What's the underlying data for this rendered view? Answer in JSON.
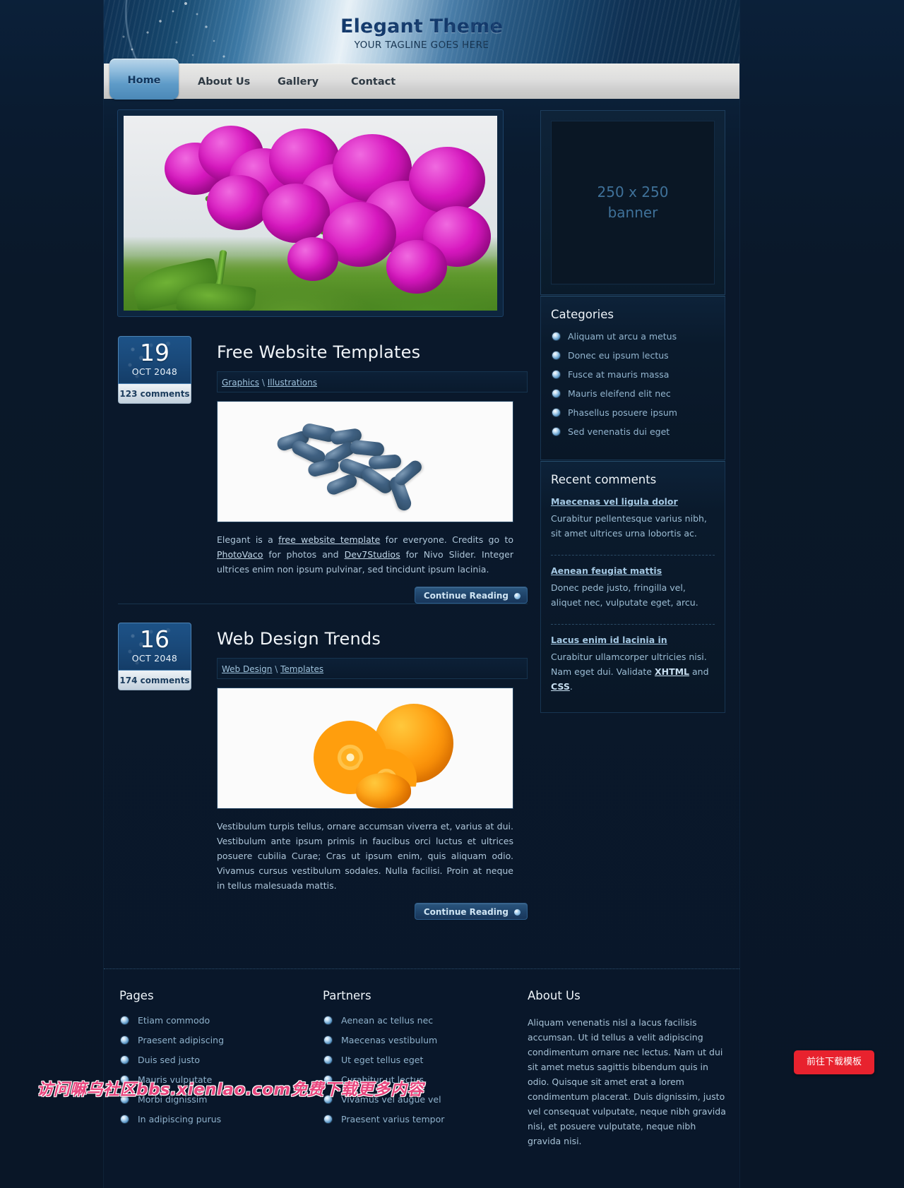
{
  "header": {
    "site_title": "Elegant Theme",
    "tagline": "YOUR TAGLINE GOES HERE"
  },
  "nav": {
    "items": [
      {
        "label": "Home",
        "active": true
      },
      {
        "label": "About Us",
        "active": false
      },
      {
        "label": "Gallery",
        "active": false
      },
      {
        "label": "Contact",
        "active": false
      }
    ]
  },
  "slider": {
    "alt": "purple orchid flowers photo"
  },
  "posts": [
    {
      "day": "19",
      "month_year": "OCT 2048",
      "comments": "123 comments",
      "title": "Free Website Templates",
      "categories": [
        "Graphics",
        "Illustrations"
      ],
      "category_separator": "\\",
      "image_alt": "blue pills photo",
      "body_parts": [
        {
          "t": "Elegant is a ",
          "link": false
        },
        {
          "t": "free website template",
          "link": true
        },
        {
          "t": " for everyone. Credits go to ",
          "link": false
        },
        {
          "t": "PhotoVaco",
          "link": true
        },
        {
          "t": " for photos and ",
          "link": false
        },
        {
          "t": "Dev7Studios",
          "link": true
        },
        {
          "t": " for Nivo Slider. Integer ultrices enim non ipsum pulvinar, sed tincidunt ipsum lacinia.",
          "link": false
        }
      ],
      "button": "Continue Reading"
    },
    {
      "day": "16",
      "month_year": "OCT 2048",
      "comments": "174 comments",
      "title": "Web Design Trends",
      "categories": [
        "Web Design",
        "Templates"
      ],
      "category_separator": "\\",
      "image_alt": "sliced oranges photo",
      "body_parts": [
        {
          "t": "Vestibulum turpis tellus, ornare accumsan viverra et, varius at dui. Vestibulum ante ipsum primis in faucibus orci luctus et ultrices posuere cubilia Curae; Cras ut ipsum enim, quis aliquam odio. Vivamus cursus vestibulum sodales. Nulla facilisi. Proin at neque in tellus malesuada mattis.",
          "link": false
        }
      ],
      "button": "Continue Reading"
    }
  ],
  "sidebar": {
    "banner": {
      "line1": "250 x 250",
      "line2": "banner"
    },
    "categories": {
      "title": "Categories",
      "items": [
        "Aliquam ut arcu a metus",
        "Donec eu ipsum lectus",
        "Fusce at mauris massa",
        "Mauris eleifend elit nec",
        "Phasellus posuere ipsum",
        "Sed venenatis dui eget"
      ]
    },
    "recent_comments": {
      "title": "Recent comments",
      "items": [
        {
          "title": "Maecenas vel ligula dolor",
          "text": "Curabitur pellentesque varius nibh, sit amet ultrices urna lobortis ac.",
          "links": []
        },
        {
          "title": "Aenean feugiat mattis",
          "text": "Donec pede justo, fringilla vel, aliquet nec, vulputate eget, arcu.",
          "links": []
        },
        {
          "title": "Lacus enim id lacinia in",
          "text_before": "Curabitur ullamcorper ultricies nisi. Nam eget dui. Validate ",
          "link1": "XHTML",
          "text_middle": " and ",
          "link2": "CSS",
          "text_after": "."
        }
      ]
    }
  },
  "footer": {
    "pages": {
      "title": "Pages",
      "items": [
        "Etiam commodo",
        "Praesent adipiscing",
        "Duis sed justo",
        "Mauris vulputate",
        "Morbi dignissim",
        "In adipiscing purus"
      ]
    },
    "partners": {
      "title": "Partners",
      "items": [
        "Aenean ac tellus nec",
        "Maecenas vestibulum",
        "Ut eget tellus eget",
        "Curabitur ut lectus",
        "Vivamus vel augue vel",
        "Praesent varius tempor"
      ]
    },
    "about": {
      "title": "About Us",
      "text": "Aliquam venenatis nisl a lacus facilisis accumsan. Ut id tellus a velit adipiscing condimentum ornare nec lectus. Nam ut dui sit amet metus sagittis bibendum quis in odio. Quisque sit amet erat a lorem condimentum placerat. Duis dignissim, justo vel consequat vulputate, neque nibh gravida nisi, et posuere vulputate, neque nibh gravida nisi."
    }
  },
  "overlay": {
    "watermark": "访问嘛乌社区bbs.xienlao.com免费下载更多内容",
    "download_button": "前往下载模板"
  },
  "colors": {
    "page_bg": "#09182b",
    "accent_blue": "#4d8cbe",
    "header_title": "#12396b",
    "download_red": "#e8222e",
    "watermark_pink": "#e8467e"
  }
}
